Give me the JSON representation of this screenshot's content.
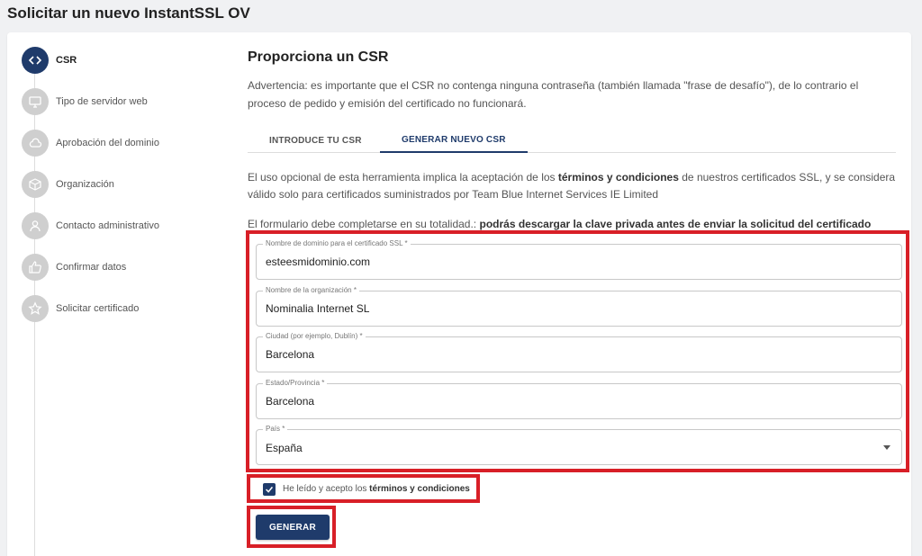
{
  "page": {
    "title": "Solicitar un nuevo InstantSSL OV"
  },
  "stepper": {
    "steps": [
      {
        "label": "CSR",
        "icon": "code-icon",
        "active": true
      },
      {
        "label": "Tipo de servidor web",
        "icon": "monitor-icon",
        "active": false
      },
      {
        "label": "Aprobación del dominio",
        "icon": "cloud-icon",
        "active": false
      },
      {
        "label": "Organización",
        "icon": "cube-icon",
        "active": false
      },
      {
        "label": "Contacto administrativo",
        "icon": "user-icon",
        "active": false
      },
      {
        "label": "Confirmar datos",
        "icon": "thumbs-up-icon",
        "active": false
      },
      {
        "label": "Solicitar certificado",
        "icon": "star-icon",
        "active": false
      }
    ]
  },
  "main": {
    "title": "Proporciona un CSR",
    "warning": "Advertencia: es importante que el CSR no contenga ninguna contraseña (también llamada \"frase de desafío\"), de lo contrario el proceso de pedido y emisión del certificado no funcionará.",
    "tabs": [
      {
        "label": "INTRODUCE TU CSR",
        "active": false
      },
      {
        "label": "GENERAR NUEVO CSR",
        "active": true
      }
    ],
    "terms_para": {
      "prefix": "El uso opcional de esta herramienta implica la aceptación de los ",
      "bold": "términos y condiciones",
      "suffix": " de nuestros certificados SSL, y se considera válido solo para certificados suministrados por Team Blue Internet Services IE Limited"
    },
    "form_note": {
      "prefix": "El formulario debe completarse en su totalidad.: ",
      "bold": "podrás descargar la clave privada antes de enviar la solicitud del certificado"
    }
  },
  "form": {
    "domain": {
      "label": "Nombre de dominio para el certificado SSL *",
      "value": "esteesmidominio.com"
    },
    "organization": {
      "label": "Nombre de la organización *",
      "value": "Nominalia Internet SL"
    },
    "city": {
      "label": "Ciudad (por ejemplo, Dublín) *",
      "value": "Barcelona"
    },
    "state": {
      "label": "Estado/Provincia *",
      "value": "Barcelona"
    },
    "country": {
      "label": "País *",
      "value": "España"
    }
  },
  "consent": {
    "prefix": "He leído y acepto los ",
    "bold": "términos y condiciones",
    "checked": true
  },
  "actions": {
    "generate_label": "GENERAR"
  },
  "colors": {
    "primary": "#1f3b6b",
    "highlight": "#d81f27",
    "inactive_step": "#cfcfcf"
  }
}
